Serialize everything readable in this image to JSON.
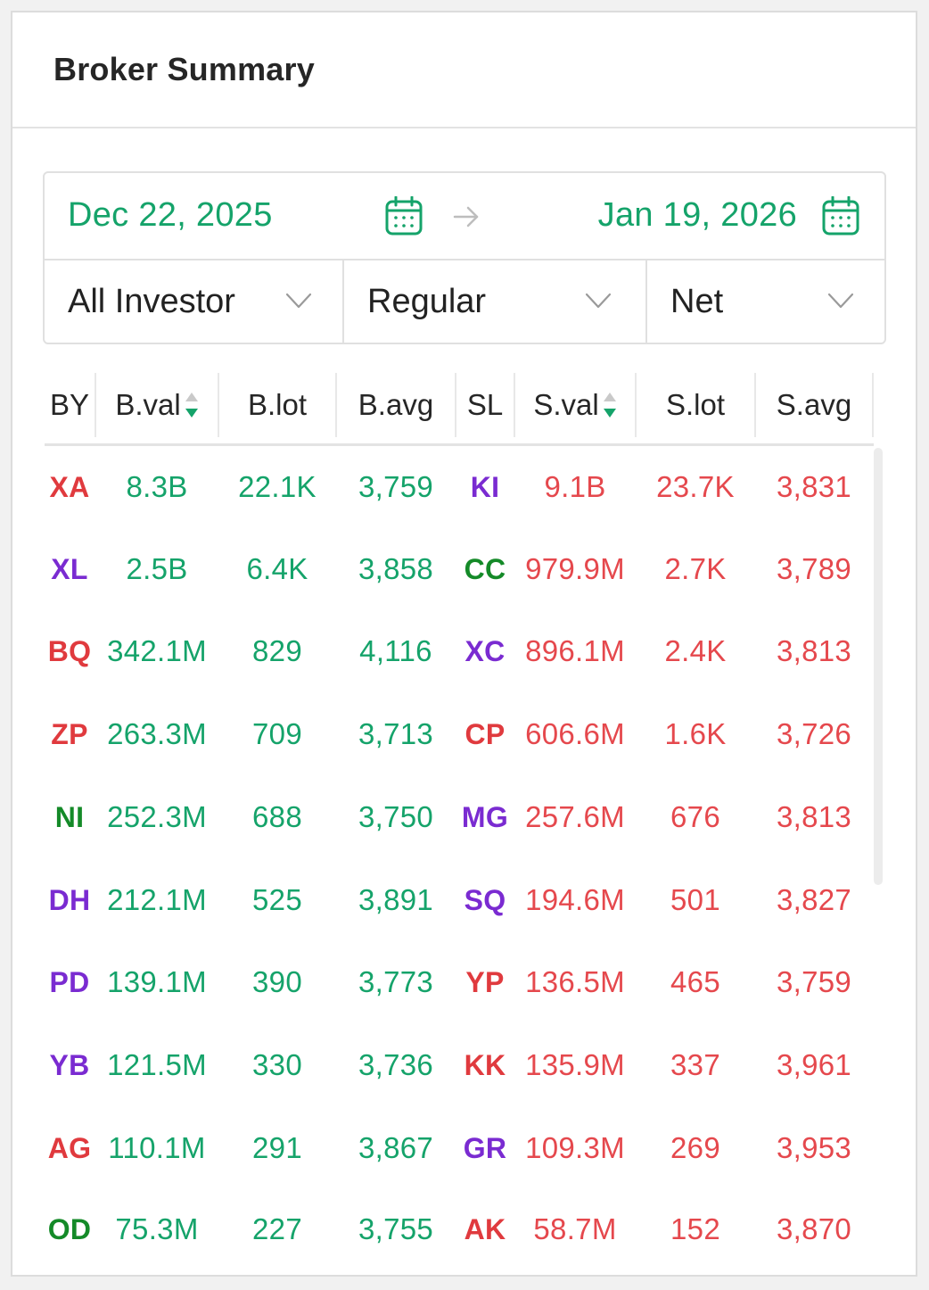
{
  "panel": {
    "title": "Broker Summary"
  },
  "filters": {
    "start_date": "Dec 22, 2025",
    "end_date": "Jan 19, 2026",
    "investor": "All Investor",
    "market": "Regular",
    "mode": "Net"
  },
  "colors": {
    "buy": "#15a36a",
    "sell": "#e5484d",
    "code_red": "#e03a3e",
    "code_purple": "#7a2bd1",
    "code_green": "#148a28"
  },
  "table": {
    "headers": {
      "by": "BY",
      "bval": "B.val",
      "blot": "B.lot",
      "bavg": "B.avg",
      "sl": "SL",
      "sval": "S.val",
      "slot": "S.lot",
      "savg": "S.avg"
    },
    "rows": [
      {
        "by": "XA",
        "by_color": "red",
        "bval": "8.3B",
        "blot": "22.1K",
        "bavg": "3,759",
        "sl": "KI",
        "sl_color": "purple",
        "sval": "9.1B",
        "slot": "23.7K",
        "savg": "3,831"
      },
      {
        "by": "XL",
        "by_color": "purple",
        "bval": "2.5B",
        "blot": "6.4K",
        "bavg": "3,858",
        "sl": "CC",
        "sl_color": "green",
        "sval": "979.9M",
        "slot": "2.7K",
        "savg": "3,789"
      },
      {
        "by": "BQ",
        "by_color": "red",
        "bval": "342.1M",
        "blot": "829",
        "bavg": "4,116",
        "sl": "XC",
        "sl_color": "purple",
        "sval": "896.1M",
        "slot": "2.4K",
        "savg": "3,813"
      },
      {
        "by": "ZP",
        "by_color": "red",
        "bval": "263.3M",
        "blot": "709",
        "bavg": "3,713",
        "sl": "CP",
        "sl_color": "red",
        "sval": "606.6M",
        "slot": "1.6K",
        "savg": "3,726"
      },
      {
        "by": "NI",
        "by_color": "green",
        "bval": "252.3M",
        "blot": "688",
        "bavg": "3,750",
        "sl": "MG",
        "sl_color": "purple",
        "sval": "257.6M",
        "slot": "676",
        "savg": "3,813"
      },
      {
        "by": "DH",
        "by_color": "purple",
        "bval": "212.1M",
        "blot": "525",
        "bavg": "3,891",
        "sl": "SQ",
        "sl_color": "purple",
        "sval": "194.6M",
        "slot": "501",
        "savg": "3,827"
      },
      {
        "by": "PD",
        "by_color": "purple",
        "bval": "139.1M",
        "blot": "390",
        "bavg": "3,773",
        "sl": "YP",
        "sl_color": "red",
        "sval": "136.5M",
        "slot": "465",
        "savg": "3,759"
      },
      {
        "by": "YB",
        "by_color": "purple",
        "bval": "121.5M",
        "blot": "330",
        "bavg": "3,736",
        "sl": "KK",
        "sl_color": "red",
        "sval": "135.9M",
        "slot": "337",
        "savg": "3,961"
      },
      {
        "by": "AG",
        "by_color": "red",
        "bval": "110.1M",
        "blot": "291",
        "bavg": "3,867",
        "sl": "GR",
        "sl_color": "purple",
        "sval": "109.3M",
        "slot": "269",
        "savg": "3,953"
      },
      {
        "by": "OD",
        "by_color": "green",
        "bval": "75.3M",
        "blot": "227",
        "bavg": "3,755",
        "sl": "AK",
        "sl_color": "red",
        "sval": "58.7M",
        "slot": "152",
        "savg": "3,870"
      }
    ]
  }
}
